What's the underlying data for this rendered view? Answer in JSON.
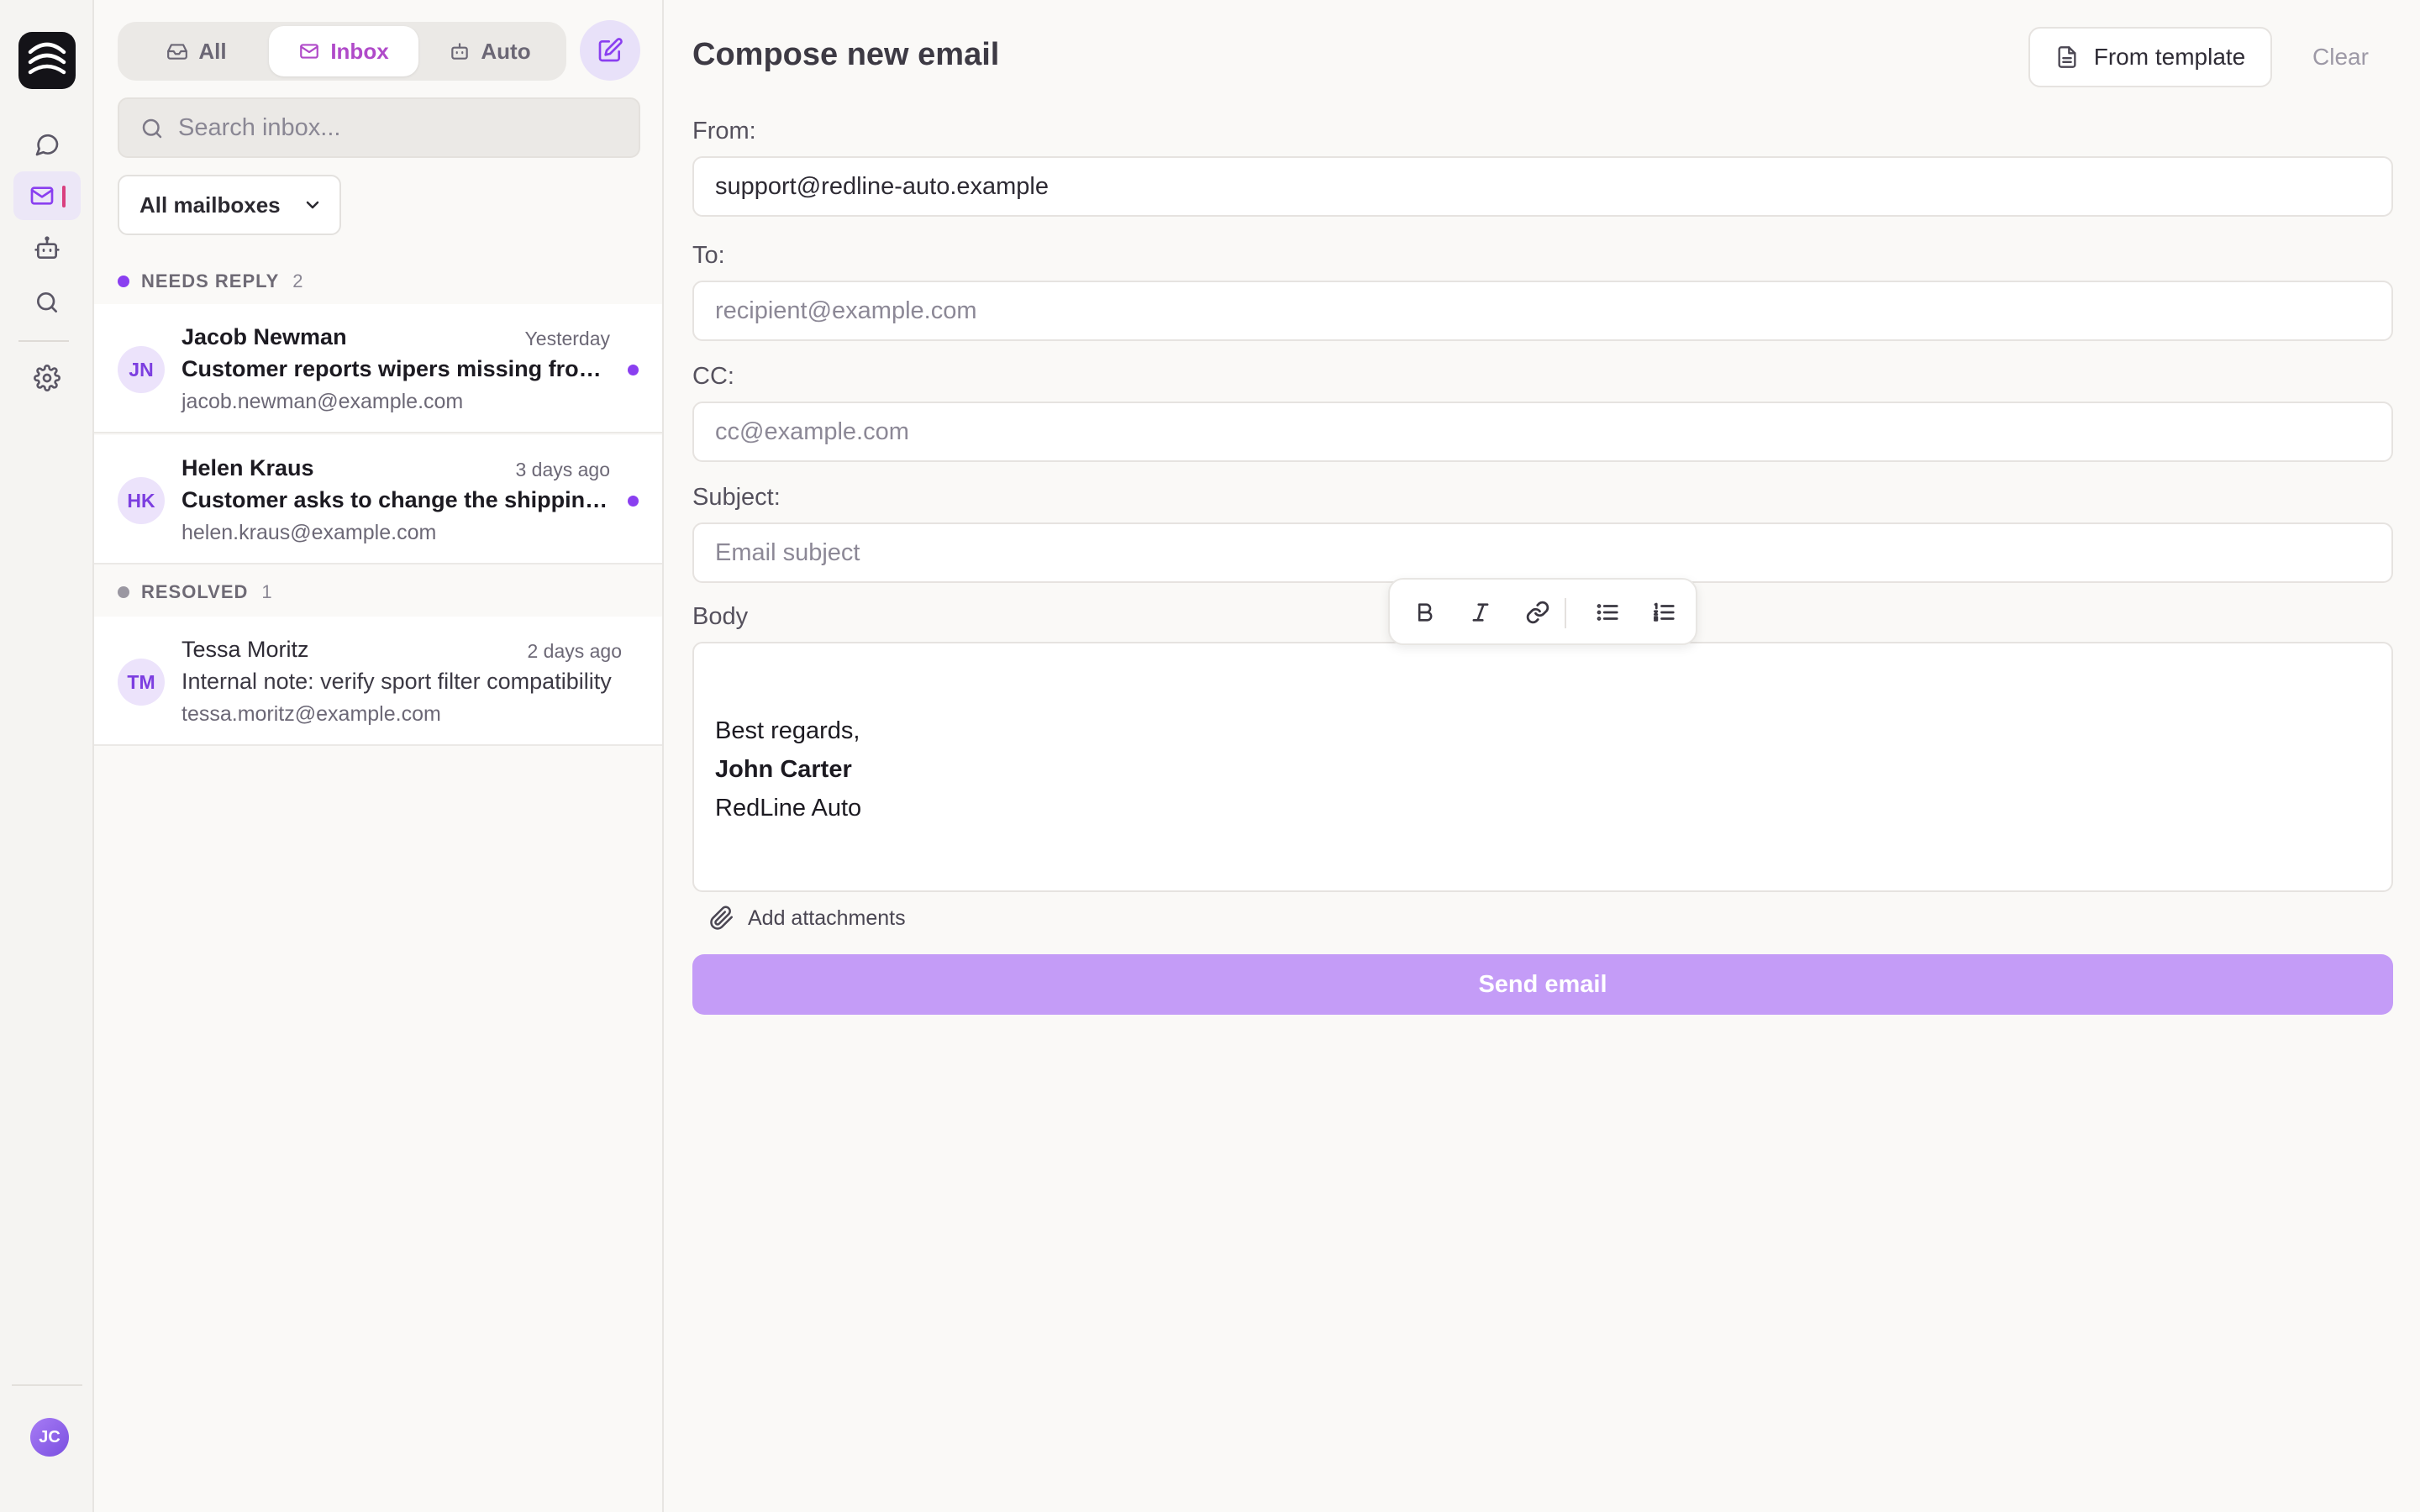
{
  "rail": {
    "nav": [
      {
        "icon": "chat-icon"
      },
      {
        "icon": "mail-icon",
        "active": true
      },
      {
        "icon": "robot-icon"
      },
      {
        "icon": "search-icon"
      },
      {
        "icon": "gear-icon"
      }
    ],
    "user_initials": "JC"
  },
  "list": {
    "tabs": [
      {
        "label": "All",
        "icon": "inbox-icon"
      },
      {
        "label": "Inbox",
        "icon": "mail-icon",
        "active": true
      },
      {
        "label": "Auto",
        "icon": "robot-icon"
      }
    ],
    "search_placeholder": "Search inbox...",
    "mailbox_filter": "All mailboxes",
    "groups": [
      {
        "title": "NEEDS REPLY",
        "count": "2",
        "color": "#8a3ff0",
        "threads": [
          {
            "initials": "JN",
            "name": "Jacob Newman",
            "time": "Yesterday",
            "subject": "Customer reports wipers missing from order",
            "email": "jacob.newman@example.com",
            "unread": true
          },
          {
            "initials": "HK",
            "name": "Helen Kraus",
            "time": "3 days ago",
            "subject": "Customer asks to change the shipping address",
            "email": "helen.kraus@example.com",
            "unread": true
          }
        ]
      },
      {
        "title": "RESOLVED",
        "count": "1",
        "color": "#9a97a1",
        "threads": [
          {
            "initials": "TM",
            "name": "Tessa Moritz",
            "time": "2 days ago",
            "subject": "Internal note: verify sport filter compatibility",
            "email": "tessa.moritz@example.com",
            "unread": false
          }
        ]
      }
    ]
  },
  "compose": {
    "title": "Compose new email",
    "from_template_label": "From template",
    "clear_label": "Clear",
    "from": {
      "label": "From:",
      "value": "support@redline-auto.example"
    },
    "to": {
      "label": "To:",
      "placeholder": "recipient@example.com"
    },
    "cc": {
      "label": "CC:",
      "placeholder": "cc@example.com"
    },
    "subject": {
      "label": "Subject:",
      "placeholder": "Email subject"
    },
    "body_label": "Body",
    "toolbar": [
      "bold-icon",
      "italic-icon",
      "link-icon",
      "bullet-list-icon",
      "numbered-list-icon"
    ],
    "body_lines": [
      "Best regards,",
      "John Carter",
      "RedLine Auto"
    ],
    "attach_label": "Add attachments",
    "send_label": "Send email"
  },
  "colors": {
    "accent": "#8a3ff0",
    "active_tab_text": "#b04ac9",
    "send_button": "#c49cf7",
    "active_indicator": "#d9407f"
  }
}
